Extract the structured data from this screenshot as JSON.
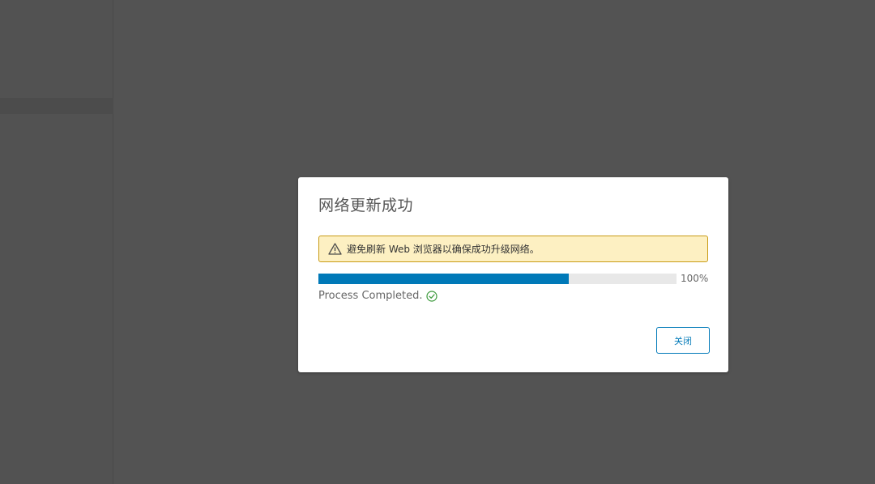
{
  "dialog": {
    "title": "网络更新成功",
    "alert": {
      "message": "避免刷新 Web 浏览器以确保成功升级网络。",
      "icon": "warning-icon",
      "color": "#c89b16"
    },
    "progress": {
      "percent_value": 0.7,
      "percent_label": "100%",
      "fill_color": "#0079b8"
    },
    "status": {
      "text": "Process Completed.",
      "icon": "check-circle-icon",
      "color": "#3c9a3c"
    },
    "close_button_label": "关闭"
  }
}
